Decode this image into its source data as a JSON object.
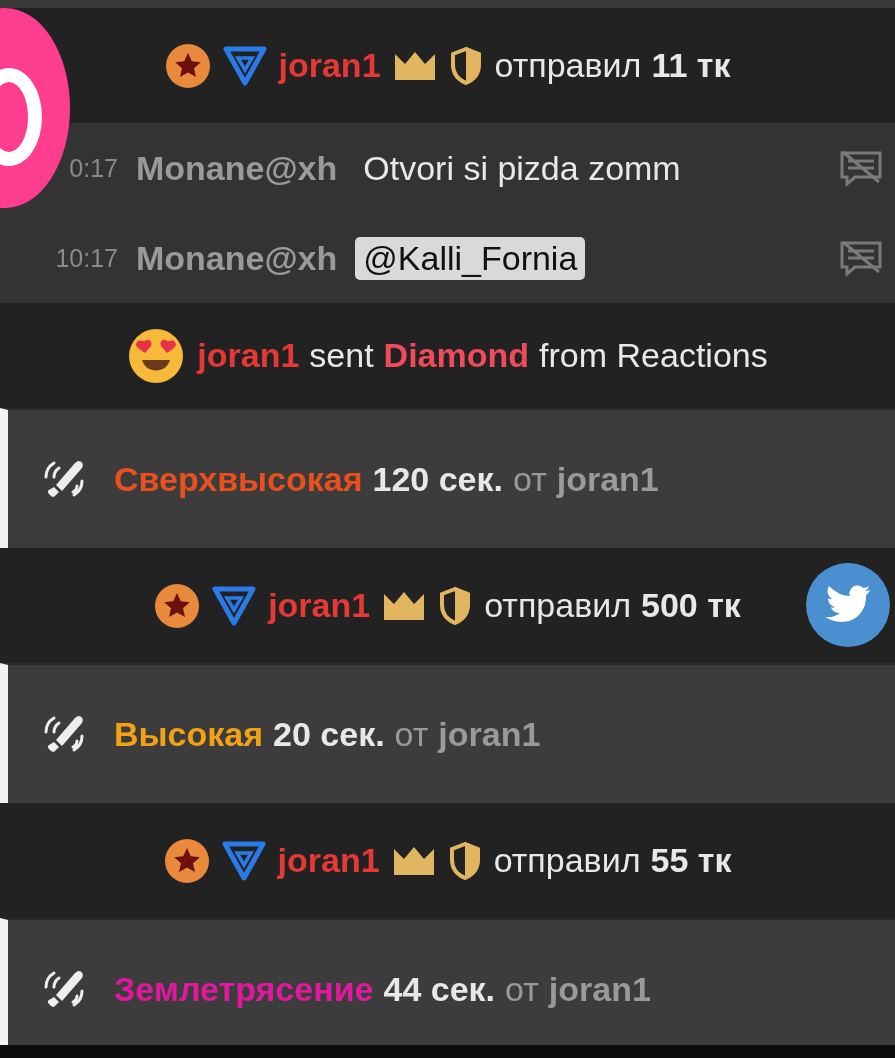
{
  "feed": [
    {
      "kind": "tip",
      "user": "joran1",
      "verb": "отправил",
      "amount": "11 тк"
    },
    {
      "kind": "message",
      "time": "0:17",
      "user": "Monane@xh",
      "text": "Otvori si pizda zomm",
      "mention": false
    },
    {
      "kind": "message",
      "time": "10:17",
      "user": "Monane@xh",
      "text": "@Kalli_Fornia",
      "mention": true
    },
    {
      "kind": "reaction",
      "user": "joran1",
      "verb": "sent",
      "gift": "Diamond",
      "source": "from Reactions"
    },
    {
      "kind": "vibration",
      "intensity": "Сверхвысокая",
      "color": "#e8501e",
      "duration": "120 сек.",
      "from": "от",
      "user": "joran1"
    },
    {
      "kind": "tip",
      "user": "joran1",
      "verb": "отправил",
      "amount": "500 тк"
    },
    {
      "kind": "vibration",
      "intensity": "Высокая",
      "color": "#f0a213",
      "duration": "20 сек.",
      "from": "от",
      "user": "joran1"
    },
    {
      "kind": "tip",
      "user": "joran1",
      "verb": "отправил",
      "amount": "55 тк"
    },
    {
      "kind": "vibration",
      "intensity": "Землетрясение",
      "color": "#e0189e",
      "duration": "44 сек.",
      "from": "от",
      "user": "joran1"
    }
  ]
}
